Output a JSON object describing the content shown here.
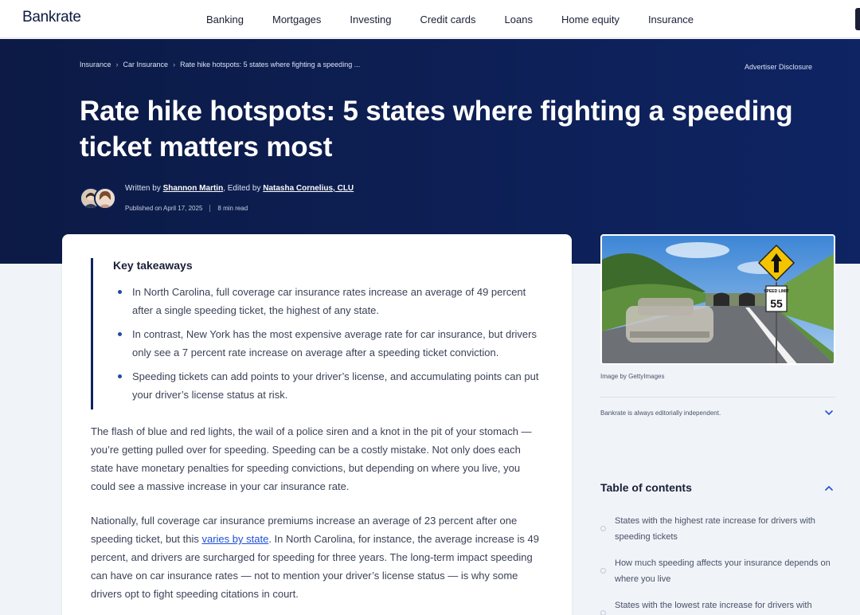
{
  "site": {
    "logo": "Bankrate"
  },
  "nav": {
    "links": [
      "Banking",
      "Mortgages",
      "Investing",
      "Credit cards",
      "Loans",
      "Home equity",
      "Insurance"
    ]
  },
  "hero": {
    "breadcrumb": [
      "Insurance",
      "Car Insurance",
      "Rate hike hotspots: 5 states where fighting a speeding ..."
    ],
    "advertiser_disclosure": "Advertiser Disclosure",
    "title": "Rate hike hotspots: 5 states where fighting a speeding ticket matters most",
    "byline": {
      "written_prefix": "Written by",
      "author": "Shannon Martin",
      "edited_prefix": ", Edited by",
      "editor": "Natasha Cornelius, CLU"
    },
    "published": "Published on April 17, 2025",
    "read_time": "8 min read"
  },
  "takeaways": {
    "title": "Key takeaways",
    "items": [
      "In North Carolina, full coverage car insurance rates increase an average of 49 percent after a single speeding ticket, the highest of any state.",
      "In contrast, New York has the most expensive average rate for car insurance, but drivers only see a 7 percent rate increase on average after a speeding ticket conviction.",
      "Speeding tickets can add points to your driver’s license, and accumulating points can put your driver’s license status at risk."
    ]
  },
  "article": {
    "para1": "The flash of blue and red lights, the wail of a police siren and a knot in the pit of your stomach — you’re getting pulled over for speeding. Speeding can be a costly mistake. Not only does each state have monetary penalties for speeding convictions, but depending on where you live, you could see a massive increase in your car insurance rate.",
    "para2_before": "Nationally, full coverage car insurance premiums increase an average of 23 percent after one speeding ticket, but this ",
    "para2_link": "varies by state",
    "para2_after": ". In North Carolina, for instance, the average increase is 49 percent, and drivers are surcharged for speeding for three years. The long-term impact speeding can have on car insurance rates — not to mention your driver’s license status — is why some drivers opt to fight speeding citations in court."
  },
  "sidebar": {
    "image_sign_text": "SPEED LIMIT",
    "image_sign_number": "55",
    "image_credit": "Image by GettyImages",
    "editorial_note": "Bankrate is always editorially independent.",
    "toc_title": "Table of contents",
    "toc_items": [
      "States with the highest rate increase for drivers with speeding tickets",
      "How much speeding affects your insurance depends on where you live",
      "States with the lowest rate increase for drivers with"
    ]
  }
}
